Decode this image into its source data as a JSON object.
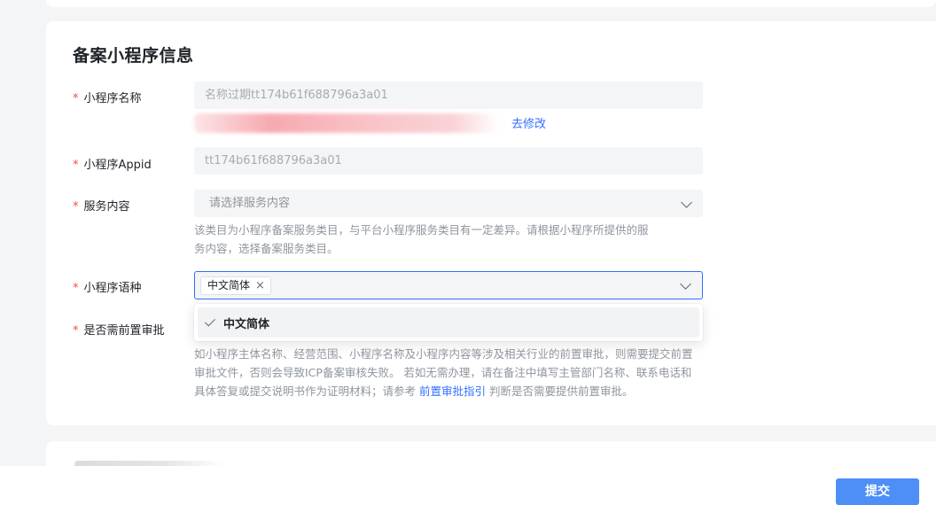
{
  "section": {
    "title": "备案小程序信息"
  },
  "name_field": {
    "label": "小程序名称",
    "value": "名称过期tt174b61f688796a3a01",
    "edit_link": "去修改"
  },
  "appid_field": {
    "label": "小程序Appid",
    "value": "tt174b61f688796a3a01"
  },
  "service_field": {
    "label": "服务内容",
    "placeholder": "请选择服务内容",
    "help_line1": "该类目为小程序备案服务类目，与平台小程序服务类目有一定差异。请根据小程序所提供的服",
    "help_line2": "务内容，选择备案服务类目。"
  },
  "language_field": {
    "label": "小程序语种",
    "selected_tag": "中文简体",
    "tag_remove": "×",
    "dropdown_option": "中文简体"
  },
  "pre_approval_field": {
    "label": "是否需前置审批",
    "help_line1": "如小程序主体名称、经营范围、小程序名称及小程序内容等涉及相关行业的前置审批，则需要提交前置",
    "help_line2": "审批文件，否则会导致ICP备案审核失败。 若如无需办理，请在备注中填写主管部门名称、联系电话和",
    "help_line3_pre": "具体答复或提交说明书作为证明材料；请参考 ",
    "help_link": "前置审批指引",
    "help_line3_post": " 判断是否需要提供前置审批。"
  },
  "required_mark": "*",
  "footer": {
    "submit_label": "提交"
  },
  "icons": {
    "chevron": "chevron-down-icon",
    "check": "check-icon",
    "close": "close-icon"
  },
  "colors": {
    "accent": "#3370ff",
    "button": "#4d8ef7",
    "required": "#f54a45"
  }
}
